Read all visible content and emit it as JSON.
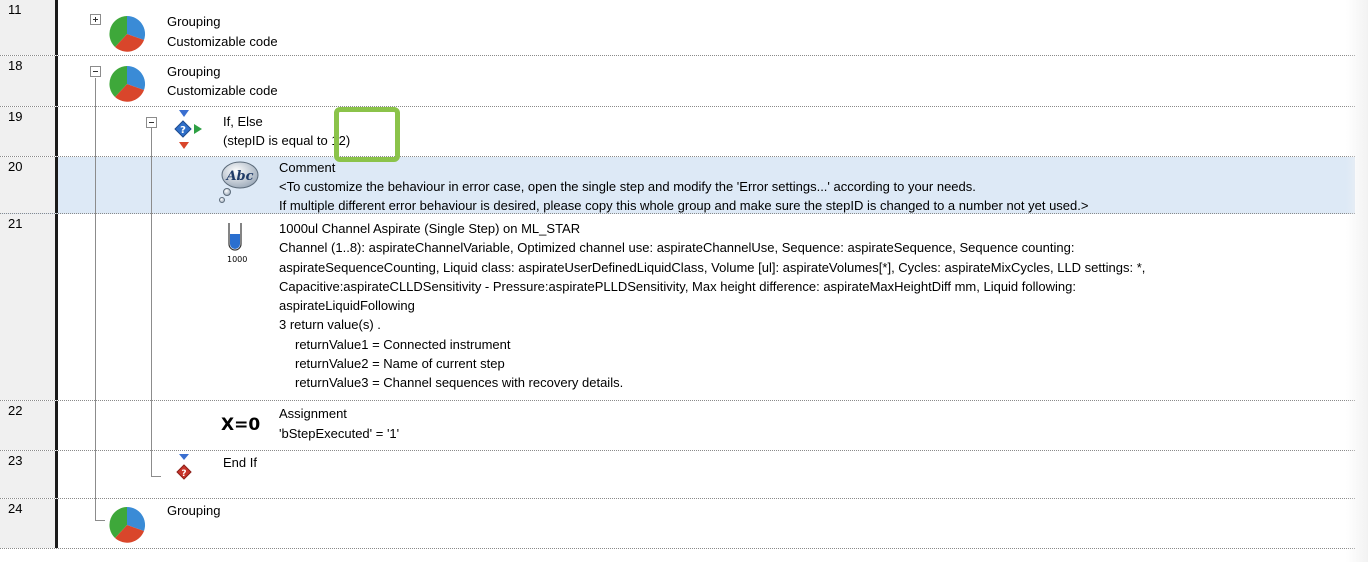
{
  "rows": [
    {
      "num": "11",
      "lines": [
        "Grouping",
        "Customizable code"
      ]
    },
    {
      "num": "18",
      "lines": [
        "Grouping",
        "Customizable code"
      ]
    },
    {
      "num": "19",
      "lines": [
        "If, Else",
        "(stepID is equal to 12)"
      ]
    },
    {
      "num": "20",
      "lines": [
        "Comment",
        "<To customize the behaviour in error case, open the single step and modify the 'Error settings...' according to your needs.",
        "If multiple different error behaviour is desired, please copy this whole group and make sure the stepID is changed to a number not yet used.>"
      ]
    },
    {
      "num": "21",
      "lines": [
        "1000ul Channel Aspirate (Single Step) on ML_STAR",
        "Channel (1..8): aspirateChannelVariable, Optimized channel use: aspirateChannelUse, Sequence: aspirateSequence, Sequence counting:",
        "aspirateSequenceCounting, Liquid class: aspirateUserDefinedLiquidClass, Volume [ul]: aspirateVolumes[*], Cycles: aspirateMixCycles, LLD settings: *,",
        "Capacitive:aspirateCLLDSensitivity - Pressure:aspiratePLLDSensitivity, Max height difference: aspirateMaxHeightDiff mm, Liquid following:",
        "aspirateLiquidFollowing",
        "3 return value(s) .",
        "returnValue1 = Connected instrument",
        "returnValue2 = Name of current step",
        "returnValue3 = Channel sequences with recovery details."
      ],
      "icon_label": "1000"
    },
    {
      "num": "22",
      "lines": [
        "Assignment",
        "'bStepExecuted' = '1'"
      ],
      "icon_label": "X=0"
    },
    {
      "num": "23",
      "lines": [
        "End If"
      ]
    },
    {
      "num": "24",
      "lines": [
        "Grouping"
      ]
    }
  ],
  "icons": {
    "grouping": "grouping-pie-icon",
    "ifelse": "if-else-diamond-icon",
    "comment": "abc-comment-icon",
    "aspirate": "pipette-tip-icon",
    "assignment": "assignment-x0-icon",
    "endif": "end-if-diamond-icon"
  },
  "colors": {
    "highlight_row": "#dde9f6",
    "annotation_box": "#8bc34a"
  }
}
